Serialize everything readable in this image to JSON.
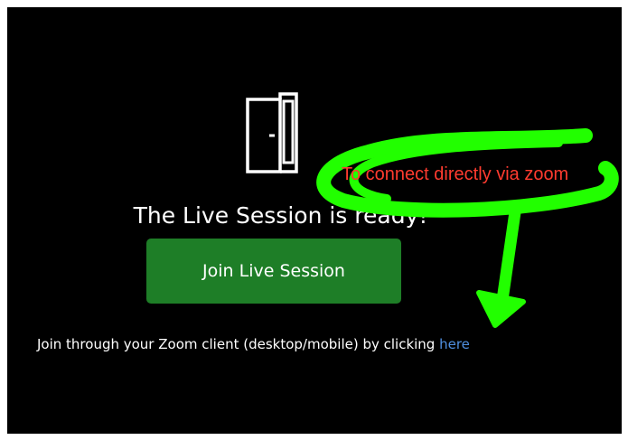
{
  "session": {
    "title": "The Live Session is ready!",
    "join_button_label": "Join Live Session",
    "zoom_prefix": "Join through your Zoom client (desktop/mobile) by clicking ",
    "zoom_link_label": "here"
  },
  "annotation": {
    "text": "To connect directly via zoom",
    "text_color": "#ff3b2f",
    "highlight_color": "#22ff00"
  },
  "icons": {
    "door": "door-icon"
  },
  "colors": {
    "background": "#000000",
    "button": "#1e7e27",
    "link": "#4f8fe0"
  }
}
